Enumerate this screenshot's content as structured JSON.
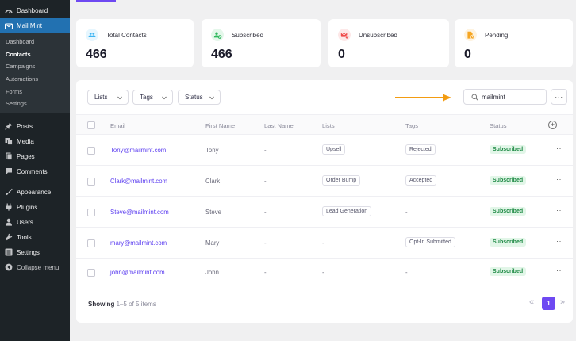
{
  "sidebar": {
    "items": [
      {
        "label": "Dashboard",
        "icon": "dashboard-icon"
      },
      {
        "label": "Mail Mint",
        "icon": "mail-mint-icon",
        "active": true
      },
      {
        "label": "Posts",
        "icon": "pin-icon"
      },
      {
        "label": "Media",
        "icon": "media-icon"
      },
      {
        "label": "Pages",
        "icon": "pages-icon"
      },
      {
        "label": "Comments",
        "icon": "comment-icon"
      },
      {
        "label": "Appearance",
        "icon": "brush-icon"
      },
      {
        "label": "Plugins",
        "icon": "plugin-icon"
      },
      {
        "label": "Users",
        "icon": "user-icon"
      },
      {
        "label": "Tools",
        "icon": "wrench-icon"
      },
      {
        "label": "Settings",
        "icon": "settings-icon"
      },
      {
        "label": "Collapse menu",
        "icon": "collapse-icon"
      }
    ],
    "submenu": [
      "Dashboard",
      "Contacts",
      "Campaigns",
      "Automations",
      "Forms",
      "Settings"
    ]
  },
  "stats": [
    {
      "label": "Total Contacts",
      "value": "466",
      "color": "#3bb4f2"
    },
    {
      "label": "Subscribed",
      "value": "466",
      "color": "#2eb85c"
    },
    {
      "label": "Unsubscribed",
      "value": "0",
      "color": "#ef4a4a"
    },
    {
      "label": "Pending",
      "value": "0",
      "color": "#f6a623"
    }
  ],
  "filters": {
    "lists": "Lists",
    "tags": "Tags",
    "status": "Status"
  },
  "search": {
    "value": "mailmint",
    "more": "···"
  },
  "columns": {
    "email": "Email",
    "first_name": "First Name",
    "last_name": "Last Name",
    "lists": "Lists",
    "tags": "Tags",
    "status": "Status"
  },
  "rows": [
    {
      "email": "Tony@mailmint.com",
      "first_name": "Tony",
      "last_name": "-",
      "list": "Upsell",
      "tag": "Rejected",
      "status": "Subscribed"
    },
    {
      "email": "Clark@mailmint.com",
      "first_name": "Clark",
      "last_name": "-",
      "list": "Order Bump",
      "tag": "Accepted",
      "status": "Subscribed"
    },
    {
      "email": "Steve@mailmint.com",
      "first_name": "Steve",
      "last_name": "-",
      "list": "Lead Generation",
      "tag": "-",
      "status": "Subscribed"
    },
    {
      "email": "mary@mailmint.com",
      "first_name": "Mary",
      "last_name": "-",
      "list": "-",
      "tag": "Opt-In Submitted",
      "status": "Subscribed"
    },
    {
      "email": "john@mailmint.com",
      "first_name": "John",
      "last_name": "-",
      "list": "-",
      "tag": "-",
      "status": "Subscribed"
    }
  ],
  "footer": {
    "showing_label": "Showing",
    "range": "1–5 of 5 items",
    "current_page": "1",
    "prev": "«",
    "next": "»"
  },
  "row_more": "···",
  "add_column": "+",
  "colors": {
    "accent": "#6e49f2",
    "arrow": "#f39c12",
    "sidebar_bg": "#1d2327",
    "active_menu": "#2271b1"
  }
}
